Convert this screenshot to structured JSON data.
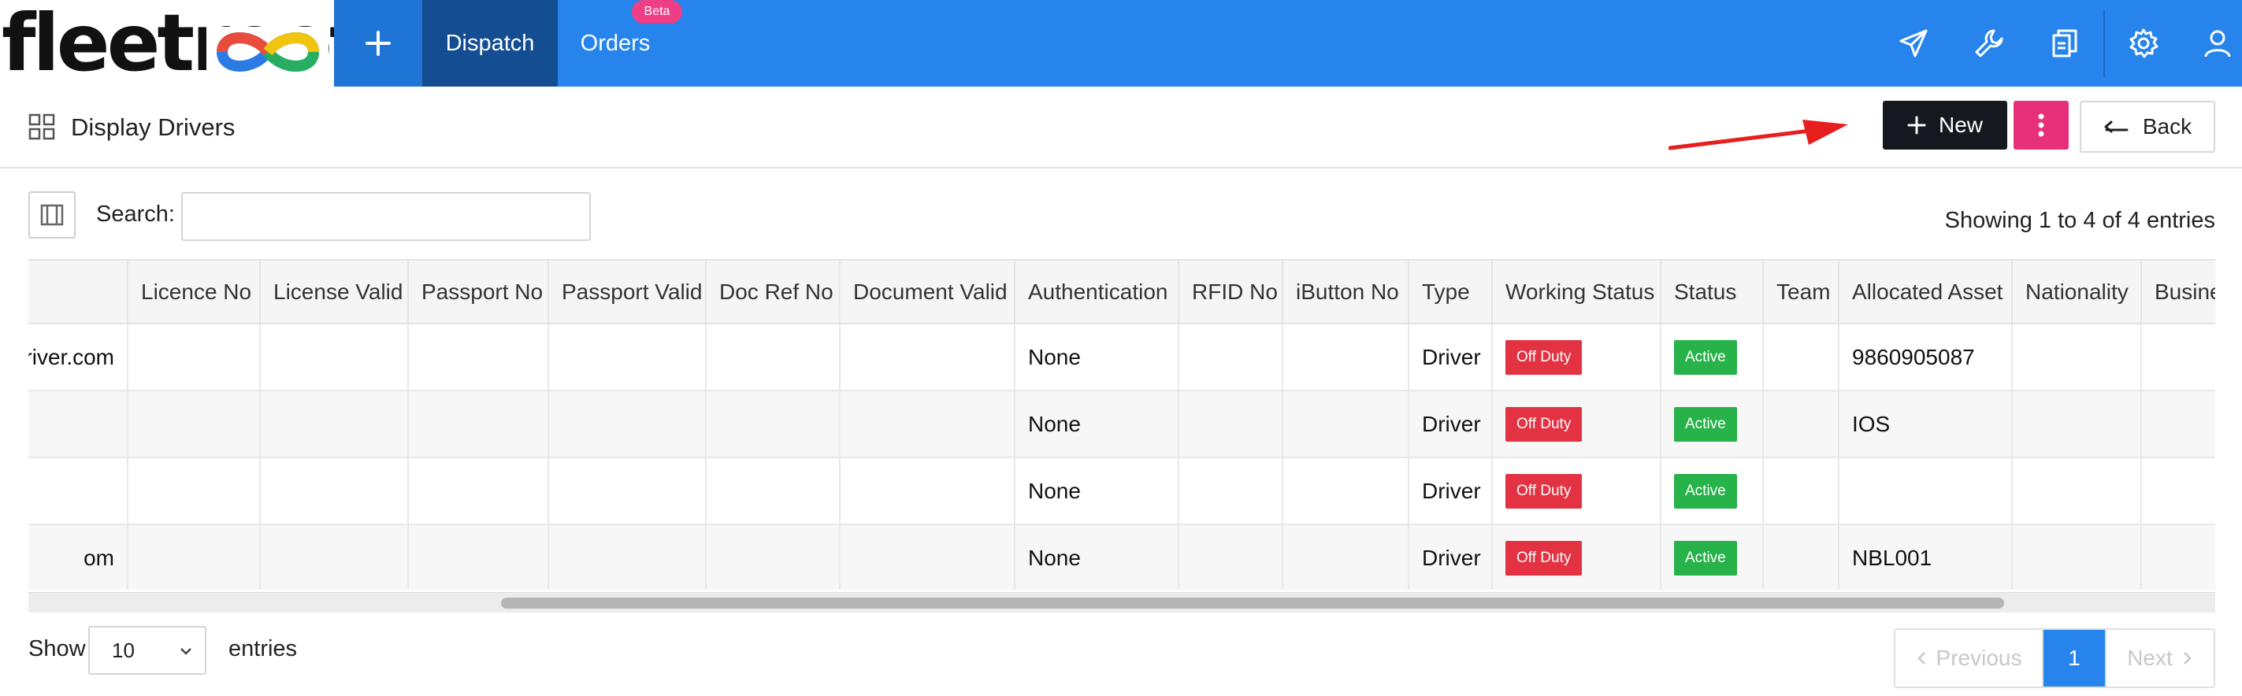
{
  "brand": {
    "logo_text": "fleetroot"
  },
  "nav": {
    "tabs": [
      {
        "label": "Dispatch",
        "active": true
      },
      {
        "label": "Orders",
        "badge": "Beta"
      }
    ],
    "icons": [
      "paper-plane-icon",
      "wrench-icon",
      "documents-icon",
      "gear-icon",
      "user-icon"
    ],
    "colors": {
      "bar": "#2684ec",
      "active_tab": "#154d93",
      "plus_tab": "#1f75d6",
      "beta": "#ef3e86"
    }
  },
  "page": {
    "title": "Display Drivers",
    "actions": {
      "new_label": "New",
      "back_label": "Back"
    }
  },
  "toolbar": {
    "search_label": "Search:",
    "search_value": "",
    "info": "Showing 1 to 4 of 4 entries"
  },
  "table": {
    "columns": [
      "",
      "Licence No",
      "License Valid",
      "Passport No",
      "Passport Valid",
      "Doc Ref No",
      "Document Valid",
      "Authentication",
      "RFID No",
      "iButton No",
      "Type",
      "Working Status",
      "Status",
      "Team",
      "Allocated Asset",
      "Nationality",
      "Business"
    ],
    "rows": [
      [
        "driver.com",
        "",
        "",
        "",
        "",
        "",
        "",
        "None",
        "",
        "",
        "Driver",
        "Off Duty",
        "Active",
        "",
        "9860905087",
        "",
        ""
      ],
      [
        "",
        "",
        "",
        "",
        "",
        "",
        "",
        "None",
        "",
        "",
        "Driver",
        "Off Duty",
        "Active",
        "",
        "IOS",
        "",
        ""
      ],
      [
        "",
        "",
        "",
        "",
        "",
        "",
        "",
        "None",
        "",
        "",
        "Driver",
        "Off Duty",
        "Active",
        "",
        "",
        "",
        ""
      ],
      [
        "om",
        "",
        "",
        "",
        "",
        "",
        "",
        "None",
        "",
        "",
        "Driver",
        "Off Duty",
        "Active",
        "",
        "NBL001",
        "",
        ""
      ]
    ],
    "status_colors": {
      "Off Duty": "#e33241",
      "Active": "#27b24a"
    }
  },
  "footer": {
    "show_label": "Show",
    "page_length": "10",
    "entries_label": "entries",
    "pagination": {
      "previous": "Previous",
      "current": "1",
      "next": "Next"
    }
  }
}
